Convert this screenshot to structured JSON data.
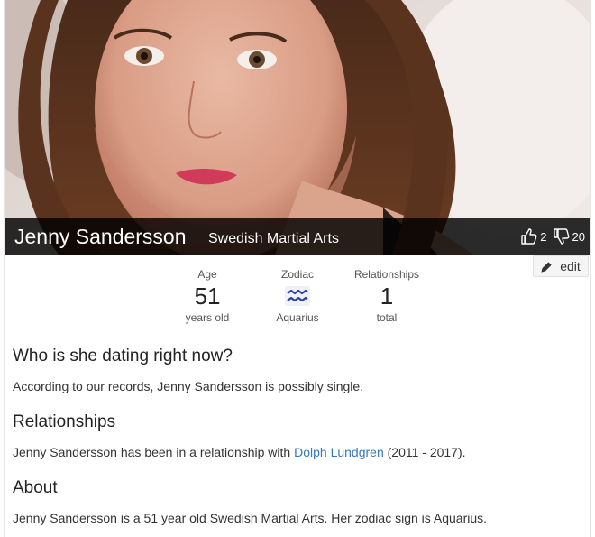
{
  "profile": {
    "name": "Jenny Sandersson",
    "occupation": "Swedish Martial Arts",
    "likes": "2",
    "dislikes": "20",
    "edit_label": "edit"
  },
  "stats": {
    "age_label": "Age",
    "age_value": "51",
    "age_sub": "years old",
    "zodiac_label": "Zodiac",
    "zodiac_icon": "aquarius-icon",
    "zodiac_sub": "Aquarius",
    "rel_label": "Relationships",
    "rel_value": "1",
    "rel_sub": "total"
  },
  "dating": {
    "heading": "Who is she dating right now?",
    "text": "According to our records, Jenny Sandersson is possibly single."
  },
  "relationships": {
    "heading": "Relationships",
    "text_before": "Jenny Sandersson has been in a relationship with ",
    "partner": "Dolph Lundgren",
    "text_after": " (2011 - 2017)."
  },
  "about": {
    "heading": "About",
    "text": "Jenny Sandersson is a 51 year old Swedish Martial Arts. Her zodiac sign is Aquarius."
  },
  "colors": {
    "link": "#337ab7",
    "zodiac": "#2c3e9e",
    "name_bar": "#000000"
  }
}
